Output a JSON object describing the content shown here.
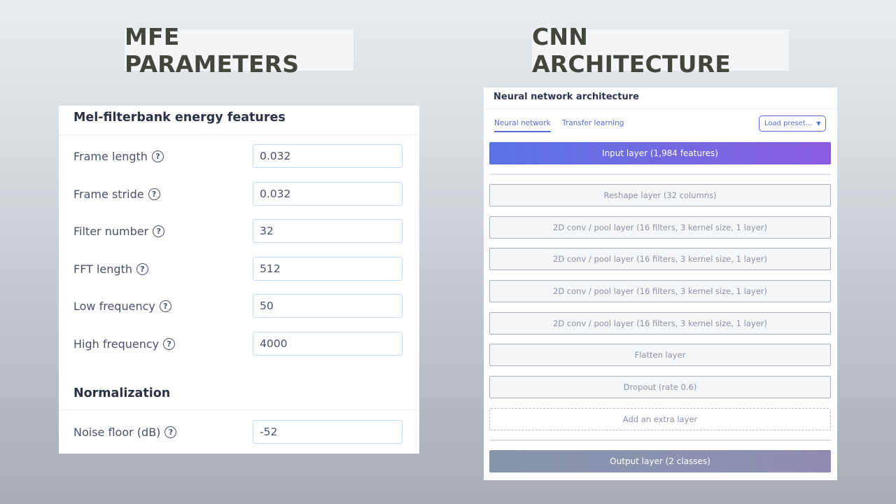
{
  "headings": {
    "mfe": "MFE PARAMETERS",
    "cnn": "CNN ARCHITECTURE"
  },
  "mfe_panel": {
    "title": "Mel-filterbank energy features",
    "params": [
      {
        "label": "Frame length",
        "value": "0.032"
      },
      {
        "label": "Frame stride",
        "value": "0.032"
      },
      {
        "label": "Filter number",
        "value": "32"
      },
      {
        "label": "FFT length",
        "value": "512"
      },
      {
        "label": "Low frequency",
        "value": "50"
      },
      {
        "label": "High frequency",
        "value": "4000"
      }
    ],
    "normalization": {
      "title": "Normalization",
      "noise_floor": {
        "label": "Noise floor (dB)",
        "value": "-52"
      }
    },
    "help_icon": "question-circle-icon"
  },
  "cnn_panel": {
    "title": "Neural network architecture",
    "tabs": [
      {
        "label": "Neural network",
        "active": true
      },
      {
        "label": "Transfer learning",
        "active": false
      }
    ],
    "load_preset": "Load preset...",
    "input_layer": "Input layer (1,984 features)",
    "layers": [
      "Reshape layer (32 columns)",
      "2D conv / pool layer (16 filters, 3 kernel size, 1 layer)",
      "2D conv / pool layer (16 filters, 3 kernel size, 1 layer)",
      "2D conv / pool layer (16 filters, 3 kernel size, 1 layer)",
      "2D conv / pool layer (16 filters, 3 kernel size, 1 layer)",
      "Flatten layer",
      "Dropout (rate 0.6)"
    ],
    "add_layer": "Add an extra layer",
    "output_layer": "Output layer (2 classes)"
  },
  "colors": {
    "accent": "#5b6bcf",
    "input_gradient_start": "#5a73e3",
    "input_gradient_end": "#8a5ce1",
    "output_layer": "#8d92b0"
  }
}
